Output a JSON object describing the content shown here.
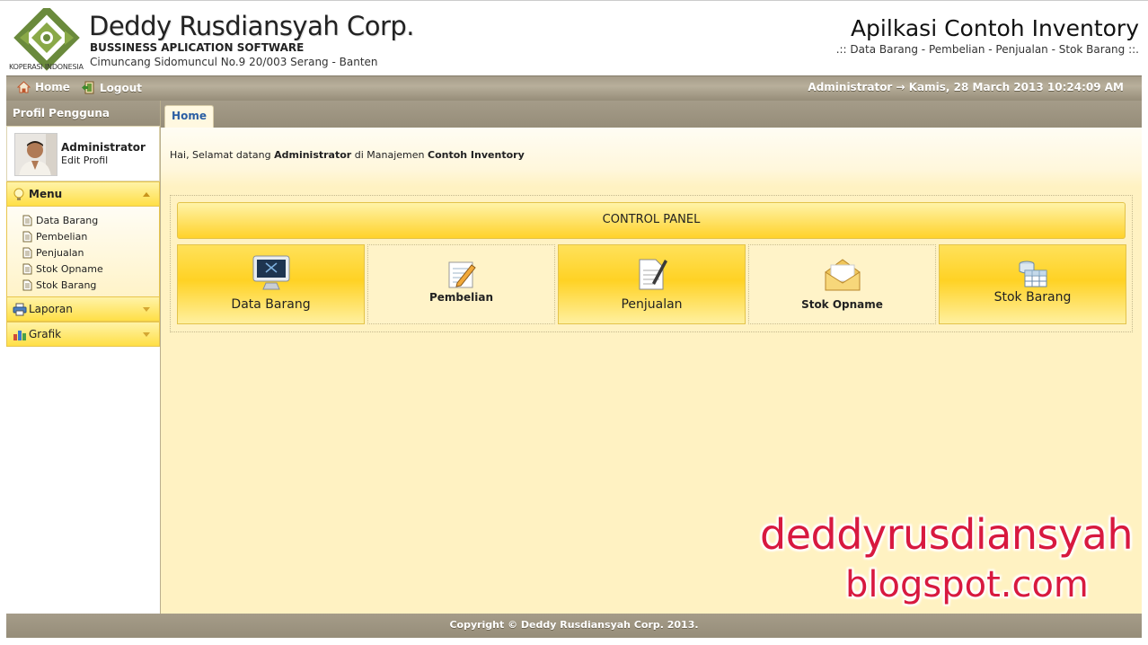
{
  "header": {
    "company_name": "Deddy Rusdiansyah Corp.",
    "company_tagline": "BUSSINESS APLICATION SOFTWARE",
    "company_address": "Cimuncang Sidomuncul No.9 20/003 Serang - Banten",
    "logo_caption": "KOPERASI INDONESIA",
    "app_title": "Apilkasi Contoh Inventory",
    "app_subtitle": ".:: Data Barang - Pembelian - Penjualan - Stok Barang ::."
  },
  "navbar": {
    "home_label": "Home",
    "logout_label": "Logout",
    "status": "Administrator → Kamis, 28 March 2013 10:24:09 AM"
  },
  "sidebar": {
    "profile_heading": "Profil Pengguna",
    "user_name": "Administrator",
    "edit_profile_label": "Edit Profil",
    "menu_label": "Menu",
    "menu_items": [
      {
        "label": "Data Barang"
      },
      {
        "label": "Pembelian"
      },
      {
        "label": "Penjualan"
      },
      {
        "label": "Stok Opname"
      },
      {
        "label": "Stok Barang"
      }
    ],
    "laporan_label": "Laporan",
    "grafik_label": "Grafik"
  },
  "main": {
    "tab_label": "Home",
    "welcome_prefix": "Hai, Selamat datang",
    "welcome_user": "Administrator",
    "welcome_middle": "di Manajemen",
    "welcome_app": "Contoh Inventory",
    "control_panel_title": "CONTROL PANEL",
    "tiles": [
      {
        "label": "Data Barang",
        "icon": "monitor-icon"
      },
      {
        "label": "Pembelian",
        "icon": "pencil-note-icon"
      },
      {
        "label": "Penjualan",
        "icon": "document-pen-icon"
      },
      {
        "label": "Stok Opname",
        "icon": "envelope-icon"
      },
      {
        "label": "Stok Barang",
        "icon": "database-table-icon"
      }
    ]
  },
  "watermark": {
    "line1": "deddyrusdiansyah",
    "line2": "blogspot.com"
  },
  "footer": {
    "copyright": "Copyright © Deddy Rusdiansyah Corp. 2013."
  },
  "colors": {
    "bar": "#a59c89",
    "gold": "#ffd224",
    "panel_bg": "#fff2c2",
    "tab_text": "#2b5fa3",
    "watermark": "#d8193f"
  }
}
